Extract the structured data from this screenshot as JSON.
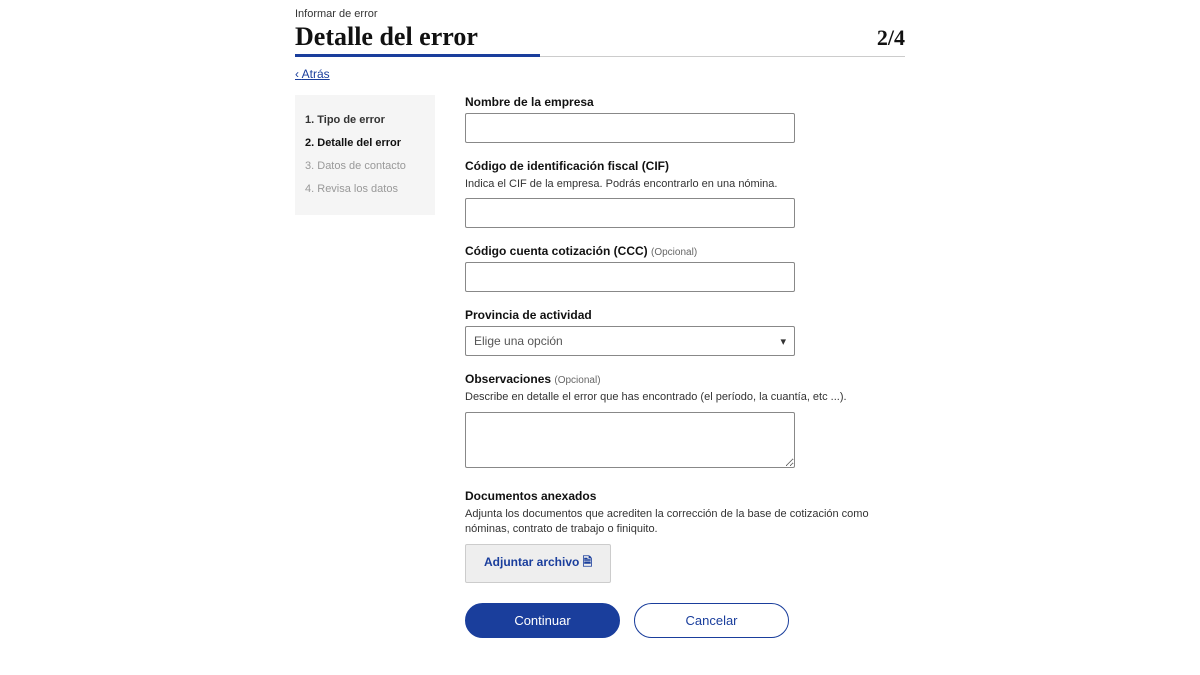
{
  "breadcrumb": "Informar de error",
  "title": "Detalle del error",
  "step": "2/4",
  "back": "Atrás",
  "sidebar": {
    "items": [
      {
        "num": "1.",
        "label": "Tipo de error",
        "state": "done"
      },
      {
        "num": "2.",
        "label": "Detalle del error",
        "state": "current"
      },
      {
        "num": "3.",
        "label": "Datos de contacto",
        "state": "future"
      },
      {
        "num": "4.",
        "label": "Revisa los datos",
        "state": "future"
      }
    ]
  },
  "form": {
    "company_name": {
      "label": "Nombre de la empresa",
      "value": ""
    },
    "cif": {
      "label": "Código de identificación fiscal (CIF)",
      "helper": "Indica el CIF de la empresa. Podrás encontrarlo en una nómina.",
      "value": ""
    },
    "ccc": {
      "label": "Código cuenta cotización (CCC)",
      "optional": "(Opcional)",
      "value": ""
    },
    "province": {
      "label": "Provincia de actividad",
      "placeholder": "Elige una opción"
    },
    "observations": {
      "label": "Observaciones",
      "optional": "(Opcional)",
      "helper": "Describe en detalle el error que has encontrado (el período, la cuantía, etc ...).",
      "value": ""
    },
    "documents": {
      "label": "Documentos anexados",
      "helper": "Adjunta los documentos que acrediten la corrección de la base de cotización como nóminas, contrato de trabajo o finiquito.",
      "attach": "Adjuntar archivo 🗎"
    }
  },
  "actions": {
    "continue": "Continuar",
    "cancel": "Cancelar"
  }
}
